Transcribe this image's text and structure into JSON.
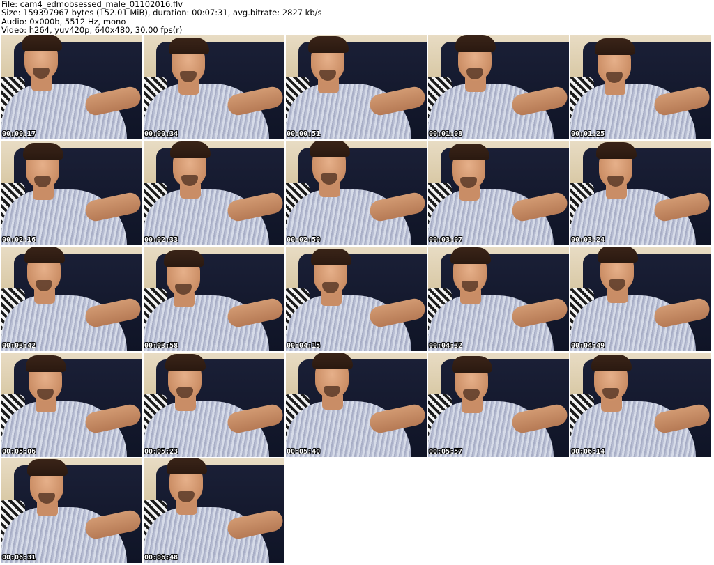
{
  "header": {
    "file": "File: cam4_edmobsessed_male_01102016.flv",
    "size": "Size: 159397967 bytes (152.01 MiB), duration: 00:07:31, avg.bitrate: 2827 kb/s",
    "audio": "Audio: 0x000b, 5512 Hz, mono",
    "video": "Video: h264, yuv420p, 640x480, 30.00 fps(r)"
  },
  "thumbnails": [
    {
      "timestamp": "00:00:17"
    },
    {
      "timestamp": "00:00:34"
    },
    {
      "timestamp": "00:00:51"
    },
    {
      "timestamp": "00:01:08"
    },
    {
      "timestamp": "00:01:25"
    },
    {
      "timestamp": "00:02:16"
    },
    {
      "timestamp": "00:02:33"
    },
    {
      "timestamp": "00:02:50"
    },
    {
      "timestamp": "00:03:07"
    },
    {
      "timestamp": "00:03:24"
    },
    {
      "timestamp": "00:03:42"
    },
    {
      "timestamp": "00:03:58"
    },
    {
      "timestamp": "00:04:15"
    },
    {
      "timestamp": "00:04:32"
    },
    {
      "timestamp": "00:04:49"
    },
    {
      "timestamp": "00:05:06"
    },
    {
      "timestamp": "00:05:23"
    },
    {
      "timestamp": "00:05:40"
    },
    {
      "timestamp": "00:05:57"
    },
    {
      "timestamp": "00:06:14"
    },
    {
      "timestamp": "00:06:31"
    },
    {
      "timestamp": "00:06:48"
    }
  ]
}
